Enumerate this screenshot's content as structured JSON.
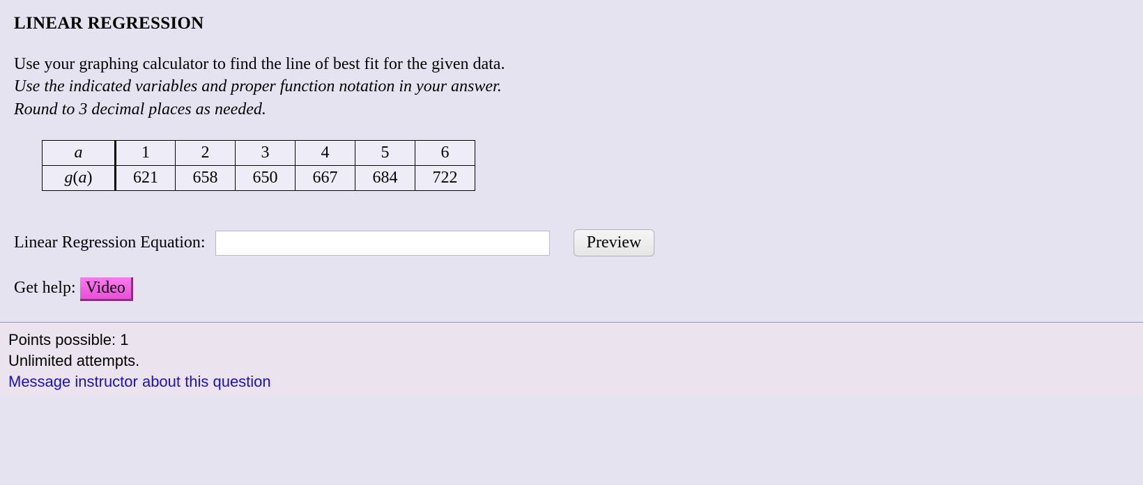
{
  "title": "LINEAR REGRESSION",
  "instructions": {
    "line1": "Use your graphing calculator to find the line of best fit for the given data.",
    "line2": "Use the indicated variables and proper function notation in your answer.",
    "line3": "Round to 3 decimal places as needed."
  },
  "table": {
    "row1_header": "a",
    "row2_header": "g(a)",
    "row1": [
      "1",
      "2",
      "3",
      "4",
      "5",
      "6"
    ],
    "row2": [
      "621",
      "658",
      "650",
      "667",
      "684",
      "722"
    ]
  },
  "answer": {
    "label": "Linear Regression Equation:",
    "value": "",
    "preview_label": "Preview"
  },
  "help": {
    "prefix": "Get help:",
    "video_label": "Video"
  },
  "footer": {
    "points": "Points possible: 1",
    "attempts": "Unlimited attempts.",
    "message_link": "Message instructor about this question"
  }
}
